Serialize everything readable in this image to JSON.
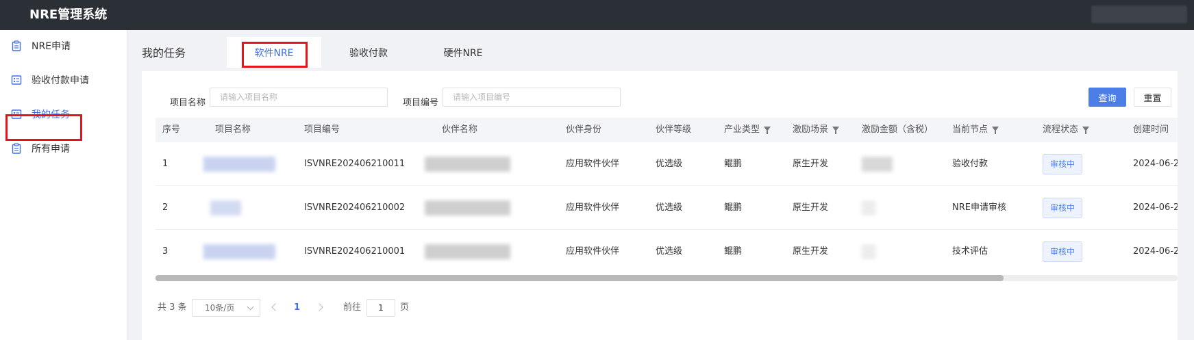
{
  "app": {
    "title": "NRE管理系统"
  },
  "sidebar": {
    "items": [
      {
        "label": "NRE申请"
      },
      {
        "label": "验收付款申请"
      },
      {
        "label": "我的任务"
      },
      {
        "label": "所有申请"
      }
    ]
  },
  "main": {
    "title": "我的任务",
    "tabs": [
      {
        "label": "软件NRE"
      },
      {
        "label": "验收付款"
      },
      {
        "label": "硬件NRE"
      }
    ]
  },
  "filters": {
    "project_name_label": "项目名称",
    "project_name_placeholder": "请输入项目名称",
    "project_no_label": "项目编号",
    "project_no_placeholder": "请输入项目编号",
    "query_button": "查询",
    "reset_button": "重置"
  },
  "table": {
    "headers": [
      "序号",
      "项目名称",
      "项目编号",
      "伙伴名称",
      "伙伴身份",
      "伙伴等级",
      "产业类型",
      "激励场景",
      "激励金额（含税）",
      "当前节点",
      "流程状态",
      "创建时间"
    ],
    "rows": [
      {
        "index": "1",
        "project_no": "ISVNRE202406210011",
        "partner_role": "应用软件伙伴",
        "partner_level": "优选级",
        "industry": "鲲鹏",
        "scenario": "原生开发",
        "node": "验收付款",
        "status": "审核中",
        "created": "2024-06-2"
      },
      {
        "index": "2",
        "project_no": "ISVNRE202406210002",
        "partner_role": "应用软件伙伴",
        "partner_level": "优选级",
        "industry": "鲲鹏",
        "scenario": "原生开发",
        "node": "NRE申请审核",
        "status": "审核中",
        "created": "2024-06-2"
      },
      {
        "index": "3",
        "project_no": "ISVNRE202406210001",
        "partner_role": "应用软件伙伴",
        "partner_level": "优选级",
        "industry": "鲲鹏",
        "scenario": "原生开发",
        "node": "技术评估",
        "status": "审核中",
        "created": "2024-06-2"
      }
    ]
  },
  "pagination": {
    "total": "共 3 条",
    "page_size": "10条/页",
    "current_page": "1",
    "goto_prefix": "前往",
    "goto_value": "1",
    "goto_suffix": "页"
  },
  "colors": {
    "accent": "#3f6ee8",
    "highlight": "#e3141b",
    "topbar": "#2b2f36"
  }
}
